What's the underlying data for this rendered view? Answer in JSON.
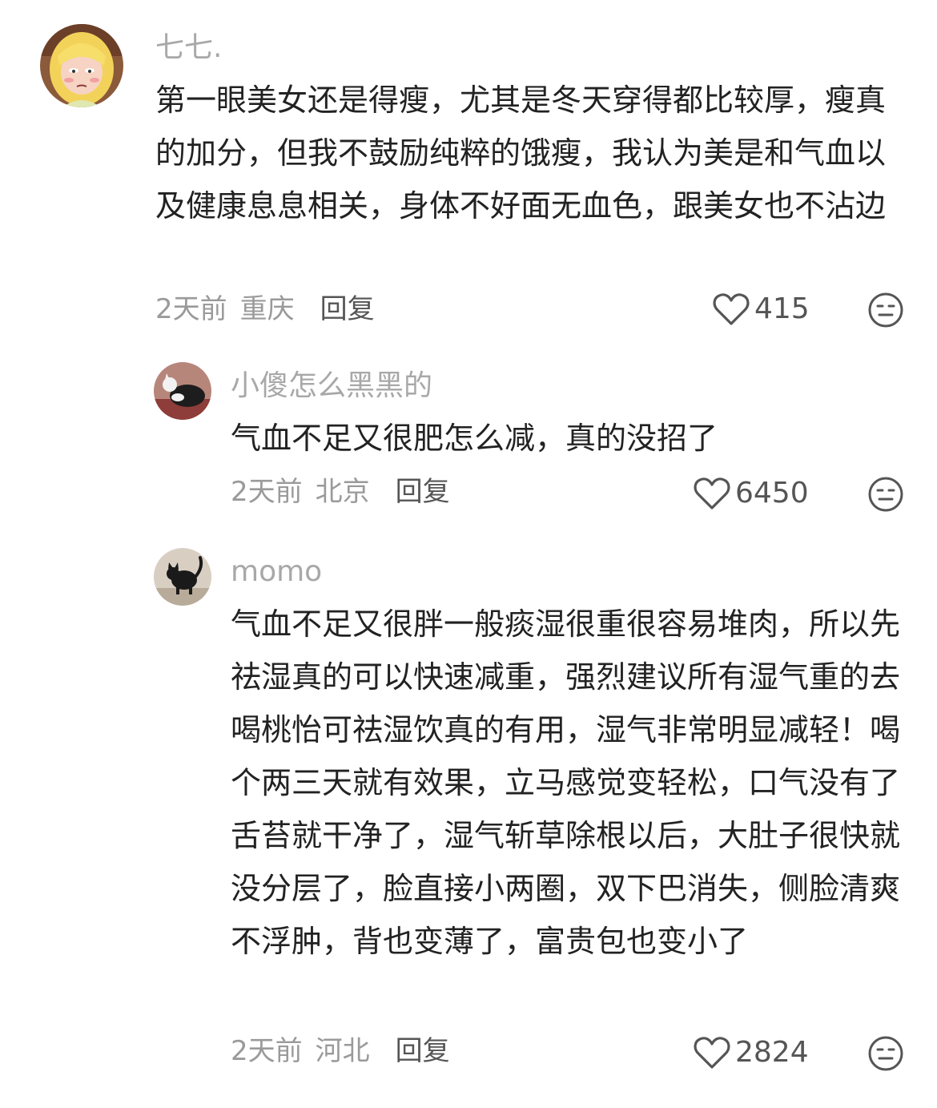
{
  "comments": [
    {
      "username": "七七.",
      "text": "第一眼美女还是得瘦，尤其是冬天穿得都比较厚，瘦真的加分，但我不鼓励纯粹的饿瘦，我认为美是和气血以及健康息息相关，身体不好面无血色，跟美女也不沾边",
      "time": "2天前",
      "location": "重庆",
      "reply_label": "回复",
      "likes": "415",
      "avatar_icon": "cartoon-girl-avatar"
    },
    {
      "username": "小傻怎么黑黑的",
      "text": "气血不足又很肥怎么减，真的没招了",
      "time": "2天前",
      "location": "北京",
      "reply_label": "回复",
      "likes": "6450",
      "avatar_icon": "cat-avatar"
    },
    {
      "username": "momo",
      "text": "气血不足又很胖一般痰湿很重很容易堆肉，所以先祛湿真的可以快速减重，强烈建议所有湿气重的去喝桃怡可祛湿饮真的有用，湿气非常明显减轻！喝个两三天就有效果，立马感觉变轻松，口气没有了舌苔就干净了，湿气斩草除根以后，大肚子很快就没分层了，脸直接小两圈，双下巴消失，侧脸清爽不浮肿，背也变薄了，富贵包也变小了",
      "time": "2天前",
      "location": "河北",
      "reply_label": "回复",
      "likes": "2824",
      "avatar_icon": "black-cat-avatar"
    }
  ],
  "colors": {
    "username": "#a8a8a8",
    "text": "#222222",
    "meta": "#9a9a9a",
    "action": "#555555"
  }
}
